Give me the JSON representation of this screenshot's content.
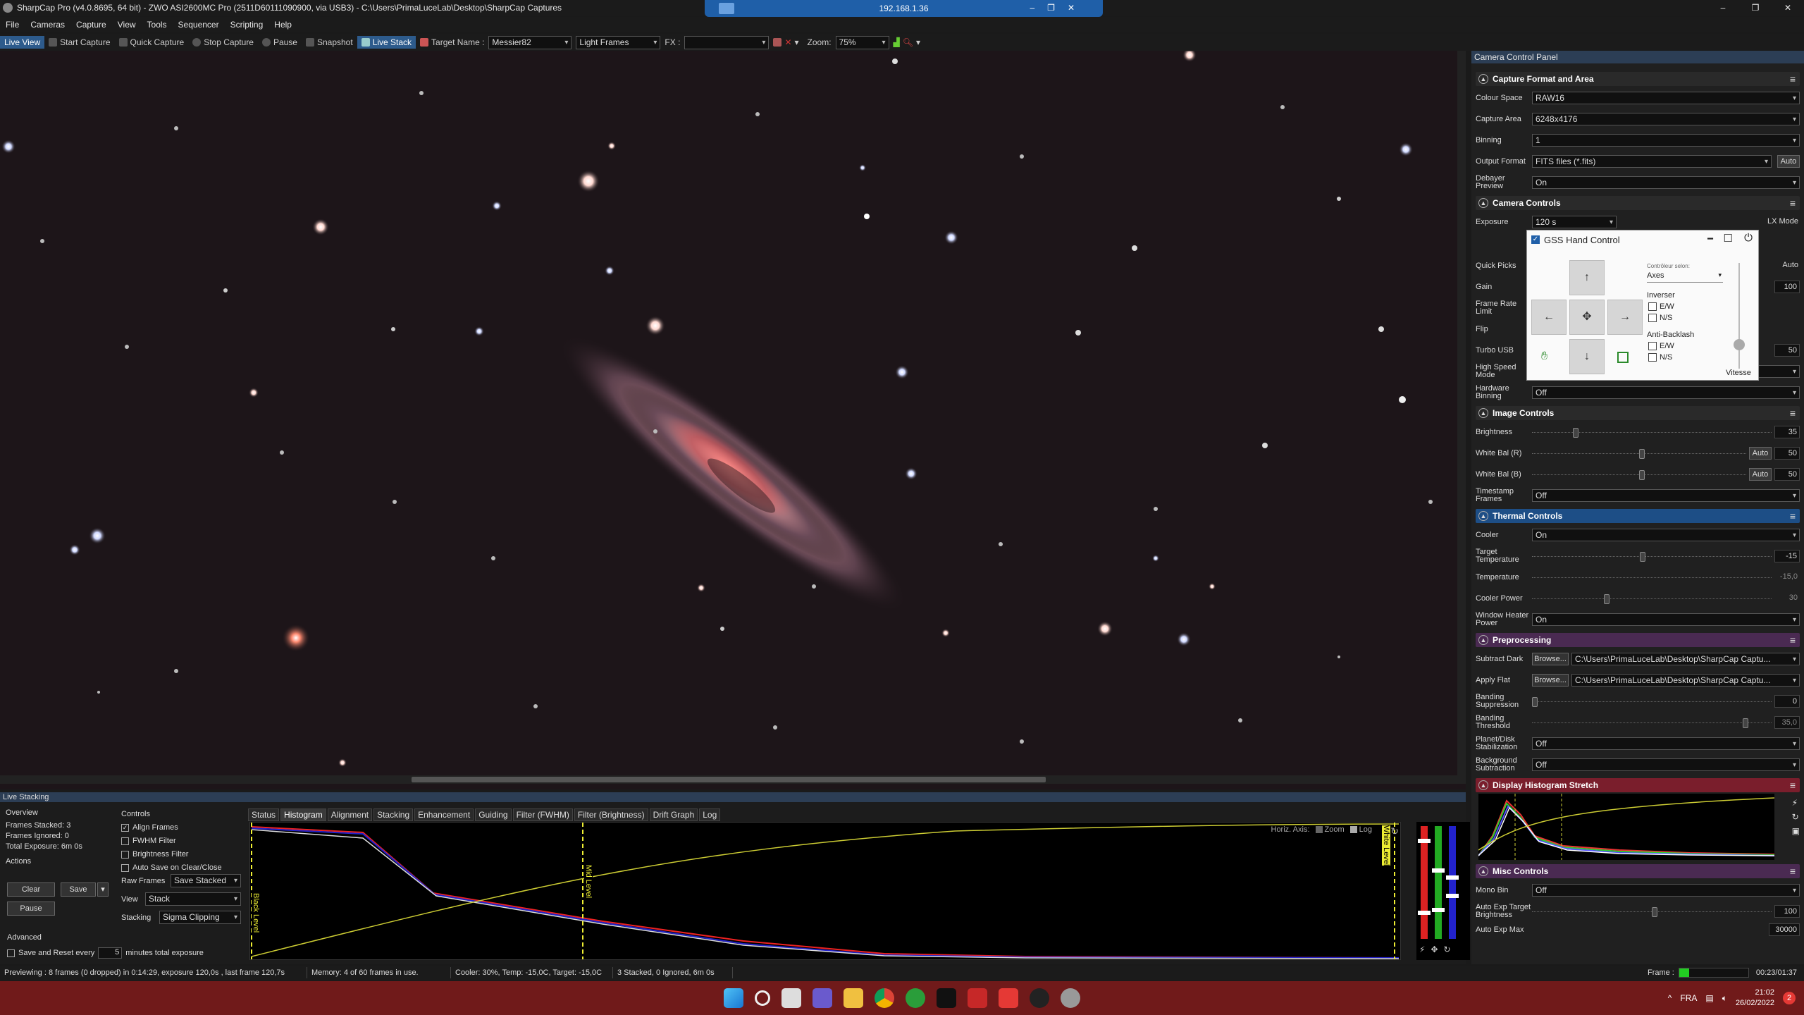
{
  "window": {
    "title": "SharpCap Pro (v4.0.8695, 64 bit) - ZWO ASI2600MC Pro (2511D60111090900, via USB3) - C:\\Users\\PrimaLuceLab\\Desktop\\SharpCap Captures",
    "controls": [
      "–",
      "❐",
      "✕"
    ]
  },
  "remote_bar": {
    "host": "192.168.1.36",
    "icons": [
      "–",
      "❐",
      "✕"
    ]
  },
  "menu": [
    "File",
    "Cameras",
    "Capture",
    "View",
    "Tools",
    "Sequencer",
    "Scripting",
    "Help"
  ],
  "toolbar": {
    "live_view": "Live View",
    "start_capture": "Start Capture",
    "quick_capture": "Quick Capture",
    "stop_capture": "Stop Capture",
    "pause": "Pause",
    "snapshot": "Snapshot",
    "live_stack": "Live Stack",
    "target_name_label": "Target Name :",
    "target_name": "Messier82",
    "frame_type": "Light Frames",
    "fx_label": "FX :",
    "fx_value": "",
    "zoom_label": "Zoom:",
    "zoom_value": "75%"
  },
  "right_panel": {
    "title": "Camera Control Panel",
    "capture_format": {
      "title": "Capture Format and Area",
      "colour_space_label": "Colour Space",
      "colour_space": "RAW16",
      "capture_area_label": "Capture Area",
      "capture_area": "6248x4176",
      "binning_label": "Binning",
      "binning": "1",
      "output_format_label": "Output Format",
      "output_format": "FITS files (*.fits)",
      "output_auto": "Auto",
      "debayer_label": "Debayer Preview",
      "debayer": "On"
    },
    "camera_controls": {
      "title": "Camera Controls",
      "exposure_label": "Exposure",
      "exposure_value": "120 s",
      "lx_mode": "LX Mode",
      "quick_picks_label": "Quick Picks",
      "quick_auto": "Auto",
      "gain_label": "Gain",
      "gain_value": "100",
      "frame_rate_label": "Frame Rate Limit",
      "flip_label": "Flip",
      "turbo_label": "Turbo USB",
      "turbo_value": "50",
      "high_speed_label": "High Speed Mode",
      "high_speed": "Off",
      "hw_binning_label": "Hardware Binning",
      "hw_binning": "Off"
    },
    "image_controls": {
      "title": "Image Controls",
      "brightness_label": "Brightness",
      "brightness": "35",
      "brightness_level": 0.17,
      "wb_r_label": "White Bal (R)",
      "wb_r": "50",
      "wb_r_level": 0.5,
      "wb_auto": "Auto",
      "wb_b_label": "White Bal (B)",
      "wb_b": "50",
      "wb_b_level": 0.5,
      "timestamp_label": "Timestamp Frames",
      "timestamp": "Off"
    },
    "thermal_controls": {
      "title": "Thermal Controls",
      "cooler_label": "Cooler",
      "cooler": "On",
      "target_temp_label": "Target Temperature",
      "target_temp": "-15",
      "target_temp_level": 0.45,
      "temperature_label": "Temperature",
      "temperature": "-15,0",
      "cooler_power_label": "Cooler Power",
      "cooler_power": "30",
      "cooler_power_level": 0.3,
      "heater_label": "Window Heater Power",
      "heater": "On"
    },
    "preprocessing": {
      "title": "Preprocessing",
      "subtract_dark_label": "Subtract Dark",
      "browse": "Browse...",
      "subtract_dark_path": "C:\\Users\\PrimaLuceLab\\Desktop\\SharpCap Captu...",
      "apply_flat_label": "Apply Flat",
      "apply_flat_path": "C:\\Users\\PrimaLuceLab\\Desktop\\SharpCap Captu...",
      "banding_supp_label": "Banding Suppression",
      "banding_supp": "0",
      "banding_supp_level": 0,
      "banding_thr_label": "Banding Threshold",
      "banding_thr": "35,0",
      "banding_thr_level": 0.88,
      "planet_label": "Planet/Disk Stabilization",
      "planet": "Off",
      "bg_sub_label": "Background Subtraction",
      "bg_sub": "Off"
    },
    "display_histogram": {
      "title": "Display Histogram Stretch"
    },
    "misc_controls": {
      "title": "Misc Controls",
      "mono_bin_label": "Mono Bin",
      "mono_bin": "Off",
      "auto_exp_target_label": "Auto Exp Target Brightness",
      "auto_exp_target": "100",
      "auto_exp_target_level": 0.5,
      "auto_exp_max_label": "Auto Exp Max",
      "auto_exp_max": "30000"
    }
  },
  "gss": {
    "title": "GSS Hand Control",
    "controller_label": "Contrôleur selon:",
    "controller_value": "Axes",
    "inverser_label": "Inverser",
    "ew": "E/W",
    "ns": "N/S",
    "anti_backlash_label": "Anti-Backlash",
    "vitesse_label": "Vitesse",
    "arrows": {
      "up": "↑",
      "down": "↓",
      "left": "←",
      "right": "→",
      "center": "✥"
    }
  },
  "live_stacking": {
    "title": "Live Stacking",
    "overview_label": "Overview",
    "frames_stacked": "Frames Stacked: 3",
    "frames_ignored": "Frames Ignored: 0",
    "total_exposure": "Total Exposure:  6m 0s",
    "actions_label": "Actions",
    "clear": "Clear",
    "save": "Save",
    "pause": "Pause",
    "advanced_label": "Advanced",
    "save_reset": "Save and Reset every",
    "save_reset_value": "5",
    "minutes_total": "minutes total exposure",
    "controls_label": "Controls",
    "align_frames": "Align Frames",
    "fwhm_filter": "FWHM Filter",
    "brightness_filter": "Brightness Filter",
    "auto_save": "Auto Save on Clear/Close",
    "raw_frames_label": "Raw Frames",
    "raw_frames": "Save Stacked",
    "view_label": "View",
    "view": "Stack",
    "stacking_label": "Stacking",
    "stacking": "Sigma Clipping",
    "tabs": [
      "Status",
      "Histogram",
      "Alignment",
      "Stacking",
      "Enhancement",
      "Guiding",
      "Filter (FWHM)",
      "Filter (Brightness)",
      "Drift Graph",
      "Log"
    ],
    "active_tab": "Histogram",
    "horiz_axis_label": "Horiz. Axis:",
    "zoom_label": "Zoom",
    "log_label": "Log",
    "black_level": "Black Level",
    "mid_level": "Mid Level",
    "white_level": "White Level"
  },
  "status_bar": {
    "previewing": "Previewing : 8 frames (0 dropped) in 0:14:29, exposure 120,0s , last frame 120,7s",
    "memory": "Memory: 4 of 60 frames in use.",
    "cooler": "Cooler: 30%, Temp: -15,0C, Target: -15,0C",
    "stacked": "3 Stacked, 0 Ignored, 6m 0s",
    "frame_label": "Frame :",
    "timer": "00:23/01:37"
  },
  "taskbar": {
    "lang": "FRA",
    "time": "21:02",
    "date": "26/02/2022",
    "notification_count": "2"
  }
}
